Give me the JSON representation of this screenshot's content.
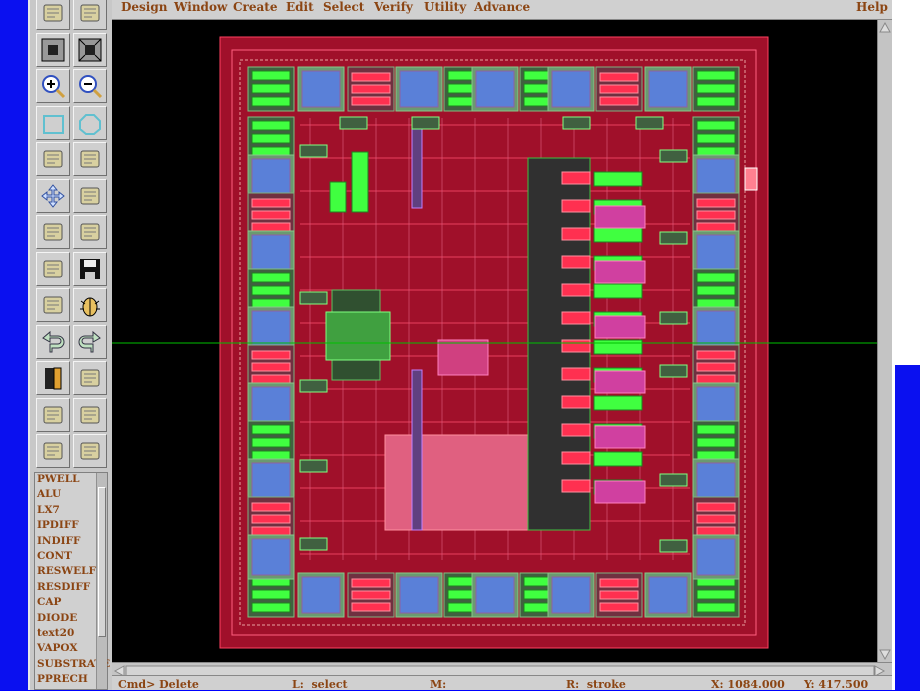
{
  "menubar": {
    "items": [
      "Design",
      "Window",
      "Create",
      "Edit",
      "Select",
      "Verify",
      "Utility",
      "Advance"
    ],
    "help": "Help"
  },
  "toolbar": {
    "icons": [
      "create-path-icon",
      "edit-properties-icon",
      "zoom-fit-icon",
      "zoom-fit-all-icon",
      "zoom-in-icon",
      "zoom-out-icon",
      "create-rectangle-icon",
      "create-polygon-icon",
      "create-wire-icon",
      "create-instance-icon",
      "move-icon",
      "stretch-icon",
      "copy-icon",
      "delete-icon",
      "chip-icon",
      "save-icon",
      "probe-icon",
      "debug-bug-icon",
      "undo-icon",
      "redo-icon",
      "exit-door-icon",
      "ruler-icon",
      "pen-icon",
      "stack-icon",
      "measure-ruler-icon",
      "clear-ruler-icon"
    ]
  },
  "layers": [
    "PWELL",
    "ALU",
    "LX7",
    "IPDIFF",
    "INDIFF",
    "CONT",
    "RESWELF",
    "RESDIFF",
    "CAP",
    "DIODE",
    "text20",
    "VAPOX",
    "SUBSTRATE",
    "PPRECH"
  ],
  "status": {
    "cmd": "Cmd> Delete",
    "left": "L:  select",
    "middle": "M:",
    "right": "R:  stroke",
    "x": "X: 1084.000",
    "y": "Y: 417.500"
  },
  "colors": {
    "background": "#000000",
    "chip": "#a0102a",
    "metal": "#ff3050",
    "pad": "#5a80d8",
    "diff": "#40ff40",
    "crosshair": "#00c000"
  }
}
